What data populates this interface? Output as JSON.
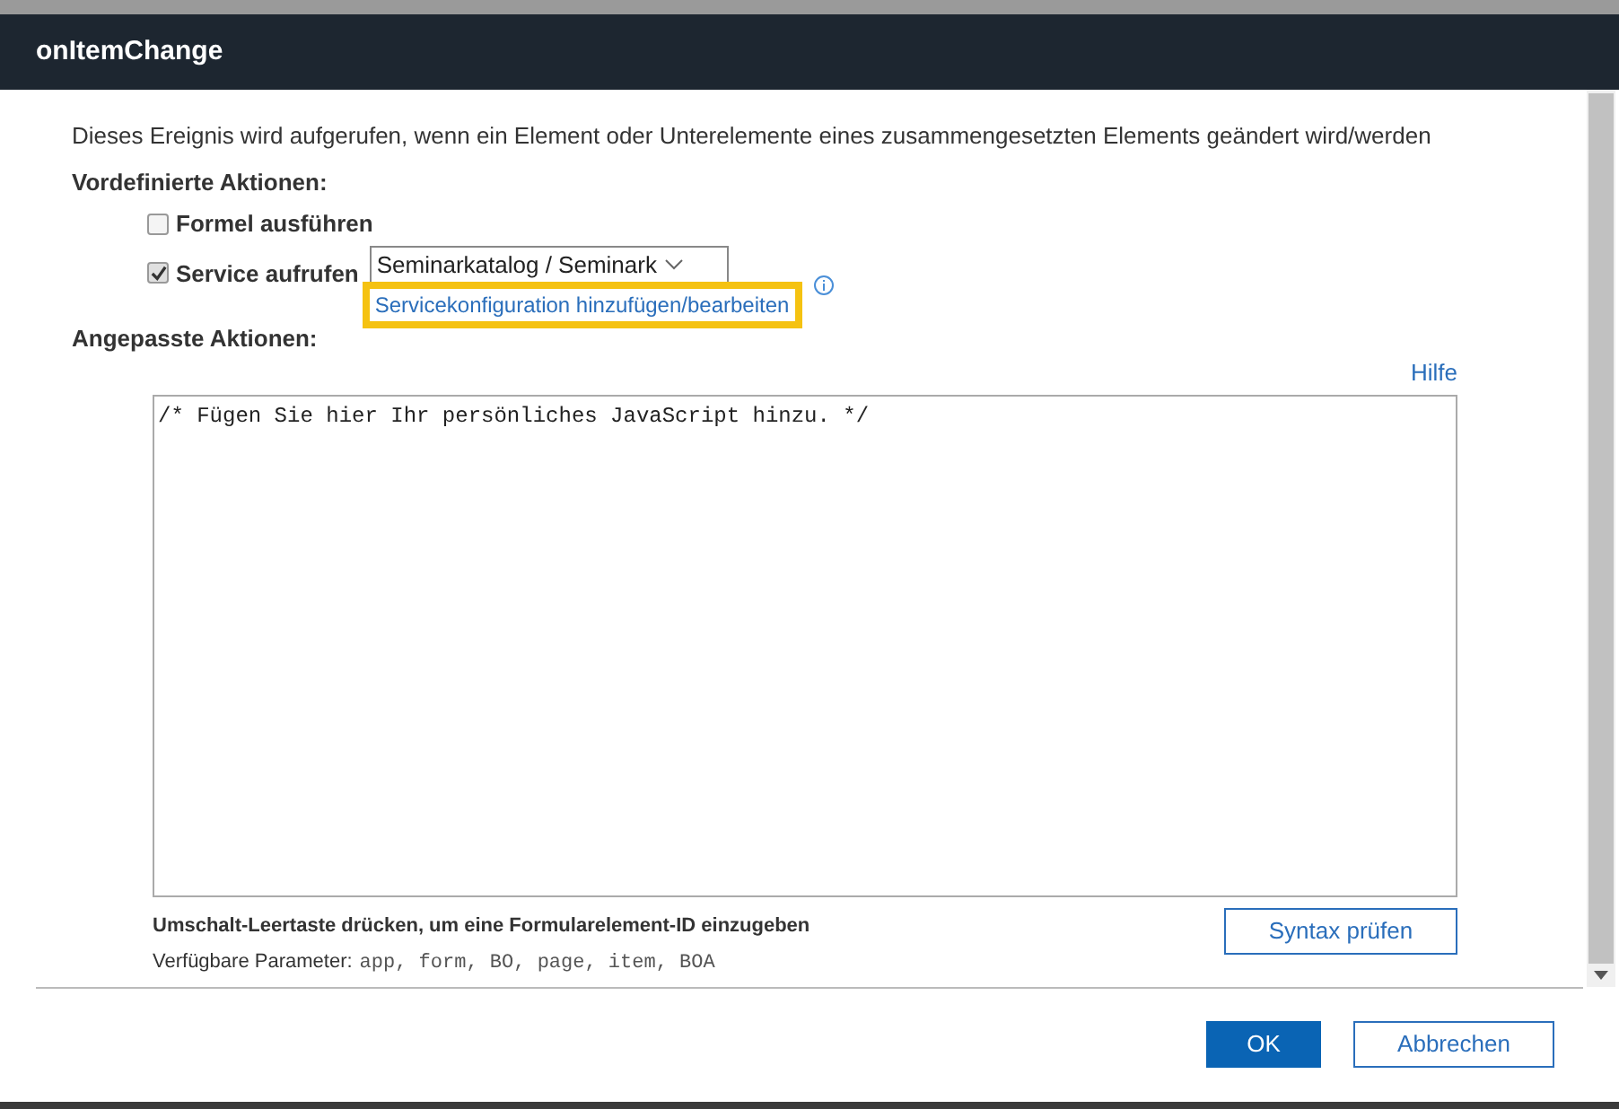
{
  "dialog": {
    "title": "onItemChange"
  },
  "description": "Dieses Ereignis wird aufgerufen, wenn ein Element oder Unterelemente eines zusammengesetzten Elements geändert wird/werden",
  "predefined": {
    "heading": "Vordefinierte Aktionen:",
    "options": [
      {
        "kind": "plain",
        "label": "Formel ausführen",
        "checked": false
      },
      {
        "kind": "service",
        "label": "Service aufrufen",
        "checked": true,
        "select_value": "Seminarkatalog / Seminark",
        "link": "Servicekonfiguration hinzufügen/bearbeiten"
      }
    ]
  },
  "custom": {
    "heading": "Angepasste Aktionen:",
    "help_link": "Hilfe",
    "code": "/* Fügen Sie hier Ihr persönliches JavaScript hinzu. */",
    "hint": "Umschalt-Leertaste drücken, um eine Formularelement-ID einzugeben",
    "params_label": "Verfügbare Parameter:",
    "params": "app, form, BO, page, item, BOA",
    "check_button": "Syntax prüfen"
  },
  "buttons": [
    {
      "kind": "primary",
      "label": "OK"
    },
    {
      "kind": "secondary",
      "label": "Abbrechen"
    }
  ]
}
